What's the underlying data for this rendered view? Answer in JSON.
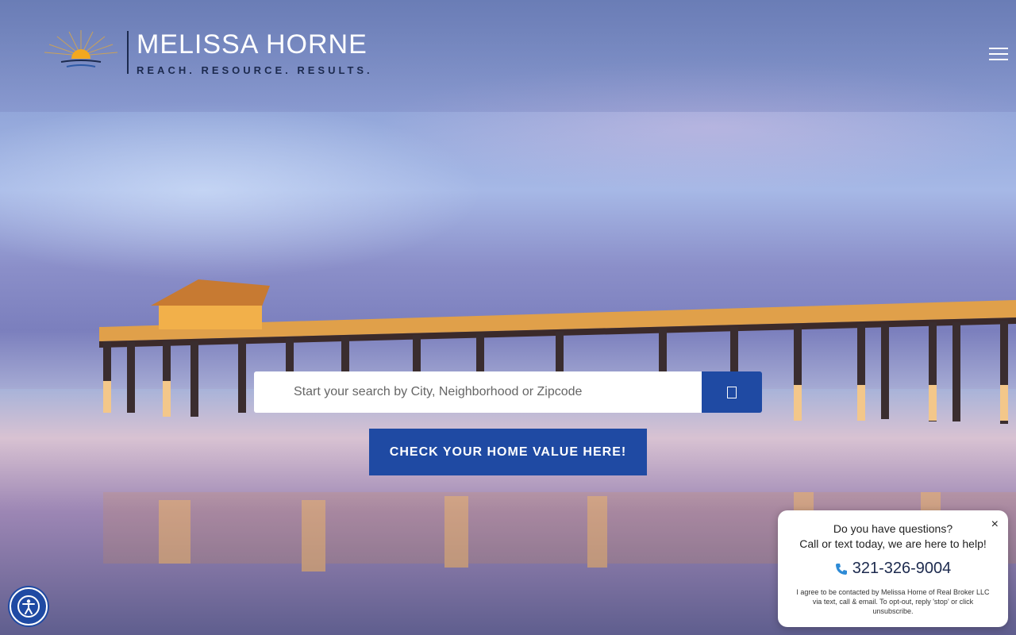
{
  "header": {
    "logo_name": "MELISSA HORNE",
    "logo_tagline": "REACH. RESOURCE. RESULTS."
  },
  "icons": {
    "menu": "hamburger-icon",
    "search": "search-icon",
    "accessibility": "accessibility-icon",
    "close": "close-icon",
    "phone": "phone-icon"
  },
  "search": {
    "placeholder": "Start your search by City, Neighborhood or Zipcode"
  },
  "cta": {
    "label": "CHECK YOUR HOME VALUE HERE!"
  },
  "chat": {
    "close": "×",
    "question": "Do you have questions?",
    "prompt": "Call or text today, we are here to help!",
    "phone": "321-326-9004",
    "disclaimer": "I agree to be contacted by Melissa Horne of Real Broker LLC via text, call & email. To opt-out, reply 'stop' or click unsubscribe."
  },
  "colors": {
    "brand_blue": "#1f4aa3",
    "navy": "#1c2a4e"
  }
}
